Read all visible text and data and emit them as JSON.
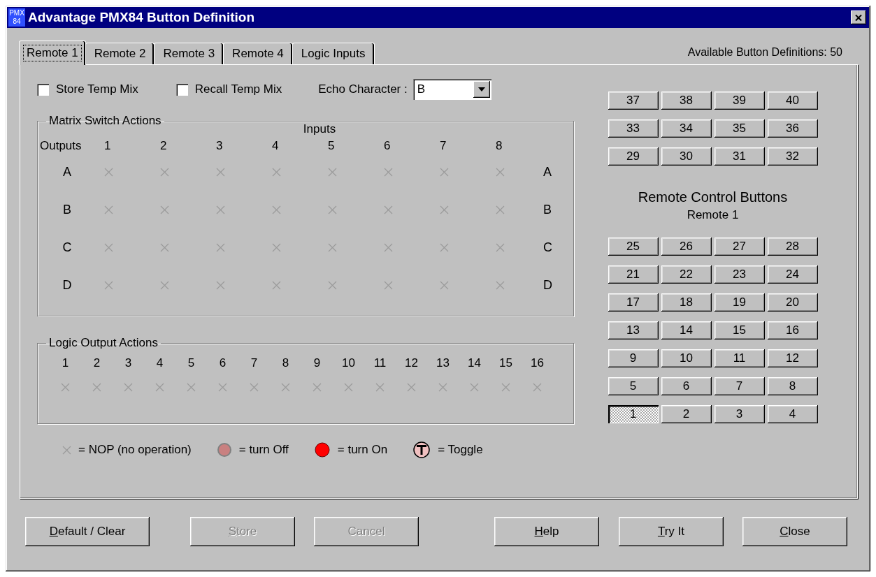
{
  "window": {
    "icon_lines": [
      "PMX",
      "84"
    ],
    "title": "Advantage PMX84 Button Definition"
  },
  "tabs": [
    {
      "label": "Remote 1",
      "selected": true
    },
    {
      "label": "Remote 2",
      "selected": false
    },
    {
      "label": "Remote 3",
      "selected": false
    },
    {
      "label": "Remote 4",
      "selected": false
    },
    {
      "label": "Logic Inputs",
      "selected": false
    }
  ],
  "available": "Available Button Definitions: 50",
  "options": {
    "checkboxes": [
      {
        "label": "Store Temp Mix",
        "checked": false
      },
      {
        "label": "Recall Temp Mix",
        "checked": false
      }
    ],
    "echo_label": "Echo Character :",
    "echo_value": "B"
  },
  "matrix": {
    "title": "Matrix Switch Actions",
    "inputs_label": "Inputs",
    "outputs_label": "Outputs",
    "inputs": [
      "1",
      "2",
      "3",
      "4",
      "5",
      "6",
      "7",
      "8"
    ],
    "rows": [
      {
        "label": "A",
        "right_label": "A",
        "cells": [
          {
            "kind": "nop"
          },
          {
            "kind": "nop"
          },
          {
            "kind": "nop"
          },
          {
            "kind": "nop"
          },
          {
            "kind": "nop"
          },
          {
            "kind": "nop"
          },
          {
            "kind": "nop"
          },
          {
            "kind": "nop"
          }
        ]
      },
      {
        "label": "B",
        "right_label": "B",
        "cells": [
          {
            "kind": "nop"
          },
          {
            "kind": "nop"
          },
          {
            "kind": "nop"
          },
          {
            "kind": "nop"
          },
          {
            "kind": "nop"
          },
          {
            "kind": "nop"
          },
          {
            "kind": "nop"
          },
          {
            "kind": "nop"
          }
        ]
      },
      {
        "label": "C",
        "right_label": "C",
        "cells": [
          {
            "kind": "nop"
          },
          {
            "kind": "nop"
          },
          {
            "kind": "nop"
          },
          {
            "kind": "nop"
          },
          {
            "kind": "nop"
          },
          {
            "kind": "nop"
          },
          {
            "kind": "nop"
          },
          {
            "kind": "nop"
          }
        ]
      },
      {
        "label": "D",
        "right_label": "D",
        "cells": [
          {
            "kind": "nop"
          },
          {
            "kind": "nop"
          },
          {
            "kind": "nop"
          },
          {
            "kind": "nop"
          },
          {
            "kind": "nop"
          },
          {
            "kind": "nop"
          },
          {
            "kind": "nop"
          },
          {
            "kind": "nop"
          }
        ]
      }
    ]
  },
  "logic": {
    "title": "Logic Output Actions",
    "outputs": [
      {
        "label": "1",
        "kind": "nop"
      },
      {
        "label": "2",
        "kind": "nop"
      },
      {
        "label": "3",
        "kind": "nop"
      },
      {
        "label": "4",
        "kind": "nop"
      },
      {
        "label": "5",
        "kind": "nop"
      },
      {
        "label": "6",
        "kind": "nop"
      },
      {
        "label": "7",
        "kind": "nop"
      },
      {
        "label": "8",
        "kind": "nop"
      },
      {
        "label": "9",
        "kind": "nop"
      },
      {
        "label": "10",
        "kind": "nop"
      },
      {
        "label": "11",
        "kind": "nop"
      },
      {
        "label": "12",
        "kind": "nop"
      },
      {
        "label": "13",
        "kind": "nop"
      },
      {
        "label": "14",
        "kind": "nop"
      },
      {
        "label": "15",
        "kind": "nop"
      },
      {
        "label": "16",
        "kind": "nop"
      }
    ]
  },
  "legend": [
    {
      "kind": "nop",
      "label": "= NOP (no operation)"
    },
    {
      "kind": "off",
      "label": "= turn Off"
    },
    {
      "kind": "on",
      "label": "= turn On"
    },
    {
      "kind": "toggle",
      "label": "= Toggle"
    }
  ],
  "remote": {
    "title": "Remote Control Buttons",
    "subtitle": "Remote 1",
    "upper_rows": [
      [
        {
          "label": "37",
          "selected": false
        },
        {
          "label": "38",
          "selected": false
        },
        {
          "label": "39",
          "selected": false
        },
        {
          "label": "40",
          "selected": false
        }
      ],
      [
        {
          "label": "33",
          "selected": false
        },
        {
          "label": "34",
          "selected": false
        },
        {
          "label": "35",
          "selected": false
        },
        {
          "label": "36",
          "selected": false
        }
      ],
      [
        {
          "label": "29",
          "selected": false
        },
        {
          "label": "30",
          "selected": false
        },
        {
          "label": "31",
          "selected": false
        },
        {
          "label": "32",
          "selected": false
        }
      ]
    ],
    "lower_rows": [
      [
        {
          "label": "25",
          "selected": false
        },
        {
          "label": "26",
          "selected": false
        },
        {
          "label": "27",
          "selected": false
        },
        {
          "label": "28",
          "selected": false
        }
      ],
      [
        {
          "label": "21",
          "selected": false
        },
        {
          "label": "22",
          "selected": false
        },
        {
          "label": "23",
          "selected": false
        },
        {
          "label": "24",
          "selected": false
        }
      ],
      [
        {
          "label": "17",
          "selected": false
        },
        {
          "label": "18",
          "selected": false
        },
        {
          "label": "19",
          "selected": false
        },
        {
          "label": "20",
          "selected": false
        }
      ],
      [
        {
          "label": "13",
          "selected": false
        },
        {
          "label": "14",
          "selected": false
        },
        {
          "label": "15",
          "selected": false
        },
        {
          "label": "16",
          "selected": false
        }
      ],
      [
        {
          "label": "9",
          "selected": false
        },
        {
          "label": "10",
          "selected": false
        },
        {
          "label": "11",
          "selected": false
        },
        {
          "label": "12",
          "selected": false
        }
      ],
      [
        {
          "label": "5",
          "selected": false
        },
        {
          "label": "6",
          "selected": false
        },
        {
          "label": "7",
          "selected": false
        },
        {
          "label": "8",
          "selected": false
        }
      ],
      [
        {
          "label": "1",
          "selected": true
        },
        {
          "label": "2",
          "selected": false
        },
        {
          "label": "3",
          "selected": false
        },
        {
          "label": "4",
          "selected": false
        }
      ]
    ]
  },
  "buttons": [
    {
      "label": "Default / Clear",
      "underline_first": true,
      "disabled": false
    },
    {
      "label": "Store",
      "underline_first": true,
      "disabled": true
    },
    {
      "label": "Cancel",
      "underline_first": false,
      "disabled": true
    },
    {
      "label": "Help",
      "underline_first": true,
      "disabled": false
    },
    {
      "label": "Try It",
      "underline_first": true,
      "disabled": false
    },
    {
      "label": "Close",
      "underline_first": true,
      "disabled": false
    }
  ]
}
